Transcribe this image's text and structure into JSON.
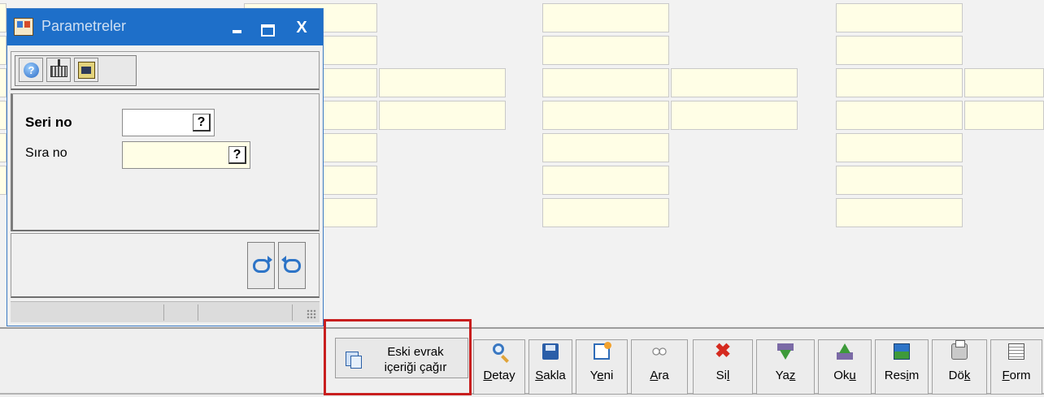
{
  "window": {
    "title": "Parametreler",
    "minimize_label": "",
    "maximize_label": "",
    "close_label": "X",
    "fields": {
      "seri_no": {
        "label": "Seri no",
        "value": "",
        "lookup": "?"
      },
      "sira_no": {
        "label": "Sıra no",
        "value": "",
        "lookup": "?"
      }
    },
    "tool_icons": [
      "help-icon",
      "keyboard-icon",
      "scanner-icon"
    ],
    "footer_icons": [
      "refresh-icon",
      "undo-icon"
    ]
  },
  "bottom_toolbar": {
    "eski_line1": "Eski evrak",
    "eski_line2": "içeriği çağır",
    "buttons": [
      {
        "pre": "",
        "u": "D",
        "post": "etay",
        "icon": "magnifier-icon"
      },
      {
        "pre": "",
        "u": "S",
        "post": "akla",
        "icon": "floppy-icon"
      },
      {
        "pre": "Y",
        "u": "e",
        "post": "ni",
        "icon": "new-document-icon"
      },
      {
        "pre": "",
        "u": "A",
        "post": "ra",
        "icon": "binoculars-icon"
      },
      {
        "pre": "Si",
        "u": "l",
        "post": "",
        "icon": "delete-icon"
      },
      {
        "pre": "Ya",
        "u": "z",
        "post": "",
        "icon": "write-icon"
      },
      {
        "pre": "Ok",
        "u": "u",
        "post": "",
        "icon": "read-icon"
      },
      {
        "pre": "Res",
        "u": "i",
        "post": "m",
        "icon": "picture-icon"
      },
      {
        "pre": "Dö",
        "u": "k",
        "post": "",
        "icon": "printer-icon"
      },
      {
        "pre": "",
        "u": "F",
        "post": "orm",
        "icon": "form-icon"
      }
    ]
  },
  "colors": {
    "title_bar": "#1e6fc9",
    "field_background": "#fffee6",
    "highlight_border": "#c81e1e"
  }
}
